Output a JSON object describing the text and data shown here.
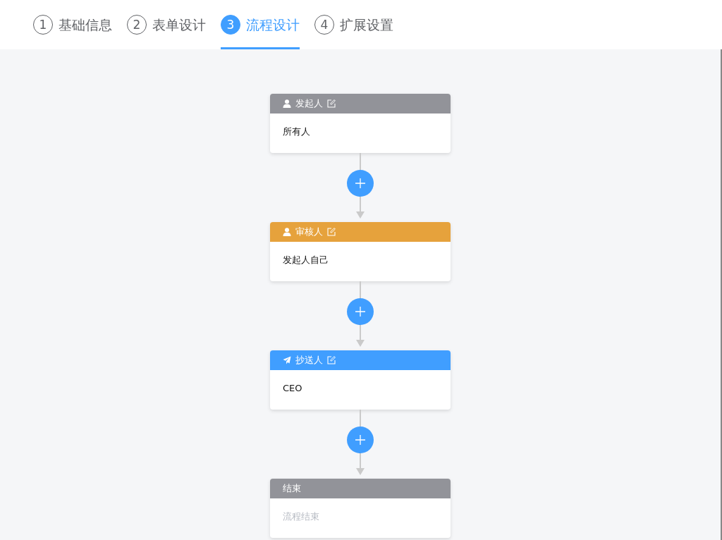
{
  "steps": [
    {
      "number": "1",
      "label": "基础信息",
      "selected": false
    },
    {
      "number": "2",
      "label": "表单设计",
      "selected": false
    },
    {
      "number": "3",
      "label": "流程设计",
      "selected": true
    },
    {
      "number": "4",
      "label": "扩展设置",
      "selected": false
    }
  ],
  "nodes": [
    {
      "kind": "start",
      "title": "发起人",
      "content": "所有人"
    },
    {
      "kind": "approver",
      "title": "审核人",
      "content": "发起人自己"
    },
    {
      "kind": "cc",
      "title": "抄送人",
      "content": "CEO"
    },
    {
      "kind": "end",
      "title": "结束",
      "content": "流程结束"
    }
  ]
}
